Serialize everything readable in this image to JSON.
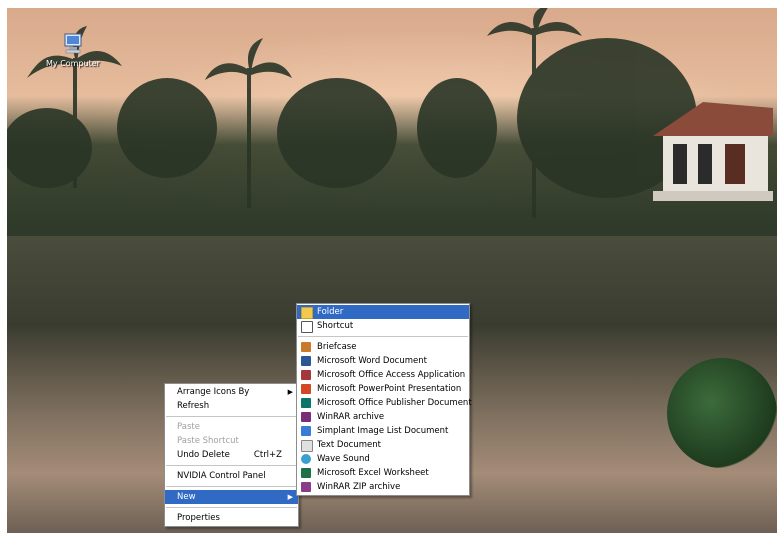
{
  "desktop": {
    "icons": [
      {
        "label": "My Computer",
        "icon": "my-computer-icon"
      }
    ]
  },
  "context_menu": {
    "items": [
      {
        "label": "Arrange Icons By",
        "submenu": true
      },
      {
        "label": "Refresh"
      },
      {
        "label": "Paste",
        "disabled": true
      },
      {
        "label": "Paste Shortcut",
        "disabled": true
      },
      {
        "label": "Undo Delete",
        "accel": "Ctrl+Z"
      },
      {
        "label": "NVIDIA Control Panel"
      },
      {
        "label": "New",
        "submenu": true,
        "highlighted": true
      },
      {
        "label": "Properties"
      }
    ]
  },
  "new_menu": {
    "items": [
      {
        "label": "Folder",
        "icon": "folder-icon",
        "color": "#f2c94c",
        "highlighted": true
      },
      {
        "label": "Shortcut",
        "icon": "shortcut-icon",
        "color": "#ffffff"
      },
      {
        "label": "Briefcase",
        "icon": "briefcase-icon",
        "color": "#c97a2b"
      },
      {
        "label": "Microsoft Word Document",
        "icon": "word-icon",
        "color": "#2b5797"
      },
      {
        "label": "Microsoft Office Access Application",
        "icon": "access-icon",
        "color": "#a4373a"
      },
      {
        "label": "Microsoft PowerPoint Presentation",
        "icon": "powerpoint-icon",
        "color": "#d24726"
      },
      {
        "label": "Microsoft Office Publisher Document",
        "icon": "publisher-icon",
        "color": "#077568"
      },
      {
        "label": "WinRAR archive",
        "icon": "winrar-icon",
        "color": "#7a2e7a"
      },
      {
        "label": "Simplant Image List Document",
        "icon": "simplant-icon",
        "color": "#3a7bd5"
      },
      {
        "label": "Text Document",
        "icon": "text-document-icon",
        "color": "#e0e0e0"
      },
      {
        "label": "Wave Sound",
        "icon": "wave-sound-icon",
        "color": "#3aa0d0"
      },
      {
        "label": "Microsoft Excel Worksheet",
        "icon": "excel-icon",
        "color": "#1e7145"
      },
      {
        "label": "WinRAR ZIP archive",
        "icon": "winrar-zip-icon",
        "color": "#8a3b8a"
      }
    ]
  }
}
